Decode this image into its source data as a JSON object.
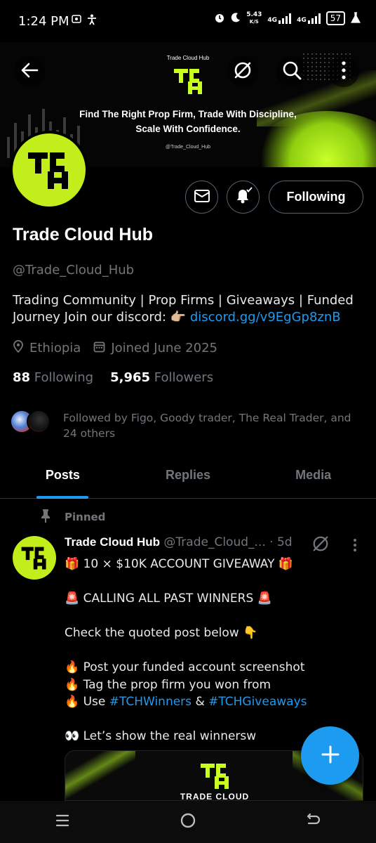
{
  "status_bar": {
    "time": "1:24 PM",
    "net_speed_value": "5.43",
    "net_speed_unit": "K/S",
    "network_1": "4G",
    "network_2": "4G",
    "battery": "57"
  },
  "banner": {
    "brand_label": "Trade Cloud Hub",
    "tagline_line1": "Find The Right Prop Firm, Trade With Discipline,",
    "tagline_line2": "Scale With Confidence.",
    "handle": "@Trade_Cloud_Hub"
  },
  "header": {
    "icons": [
      "back-arrow-icon",
      "grok-icon",
      "search-icon",
      "more-vertical-icon"
    ]
  },
  "profile": {
    "name": "Trade Cloud Hub",
    "handle": "@Trade_Cloud_Hub",
    "bio_text": "Trading Community | Prop Firms | Giveaways | Funded Journey Join our discord: 👉🏼 ",
    "bio_link": "discord.gg/v9EgGp8znB",
    "location": "Ethiopia",
    "joined": "Joined June 2025",
    "following_count": "88",
    "following_label": "Following",
    "followers_count": "5,965",
    "followers_label": "Followers",
    "followed_by": "Followed by Figo, Goody trader, The Real Trader, and 24 others",
    "follow_button": "Following"
  },
  "tabs": [
    {
      "label": "Posts",
      "active": true
    },
    {
      "label": "Replies",
      "active": false
    },
    {
      "label": "Media",
      "active": false
    }
  ],
  "post": {
    "pinned_label": "Pinned",
    "author_name": "Trade Cloud Hub",
    "author_handle": "@Trade_Cloud_...",
    "time": "· 5d",
    "line1": "🎁 10 × $10K ACCOUNT GIVEAWAY 🎁",
    "line2": "🚨 CALLING ALL PAST WINNERS 🚨",
    "line3": "Check the quoted post below 👇",
    "line4": "🔥 Post your funded account screenshot",
    "line5": "🔥 Tag the prop firm you won from",
    "line6_prefix": "🔥 Use ",
    "hashtag1": "#TCHWinners",
    "line6_mid": " & ",
    "hashtag2": "#TCHGiveaways",
    "line7": "👀 Let’s show the real winnersw",
    "media_caption": "TRADE CLOUD"
  },
  "colors": {
    "accent": "#1d9bf0",
    "brand_lime": "#c2ee1c",
    "muted_text": "#71767b",
    "background": "#000000"
  }
}
